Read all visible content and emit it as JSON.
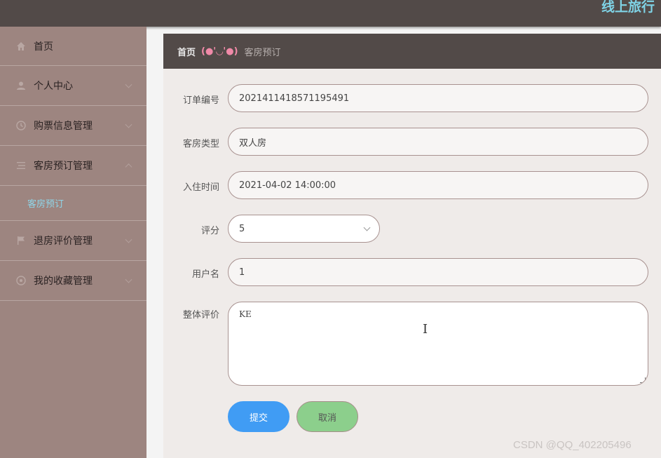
{
  "app": {
    "title": "线上旅行"
  },
  "sidebar": {
    "items": [
      {
        "label": "首页",
        "icon": "home-icon"
      },
      {
        "label": "个人中心",
        "icon": "user-icon"
      },
      {
        "label": "购票信息管理",
        "icon": "ticket-icon"
      },
      {
        "label": "客房预订管理",
        "icon": "list-icon",
        "expanded": true,
        "children": [
          {
            "label": "客房预订"
          }
        ]
      },
      {
        "label": "退房评价管理",
        "icon": "flag-icon"
      },
      {
        "label": "我的收藏管理",
        "icon": "star-icon"
      }
    ]
  },
  "breadcrumb": {
    "home": "首页",
    "separator": "(●'◡'●)",
    "current": "客房预订"
  },
  "form": {
    "order_no": {
      "label": "订单编号",
      "value": "2021411418571195491"
    },
    "room_type": {
      "label": "客房类型",
      "value": "双人房"
    },
    "checkin_time": {
      "label": "入住时间",
      "value": "2021-04-02 14:00:00"
    },
    "rating": {
      "label": "评分",
      "value": "5"
    },
    "username": {
      "label": "用户名",
      "value": "1"
    },
    "review": {
      "label": "整体评价",
      "value": "KE"
    }
  },
  "buttons": {
    "submit": "提交",
    "cancel": "取消"
  },
  "watermark": "CSDN @QQ_402205496",
  "colors": {
    "header": "#524a48",
    "sidebar": "#9d8580",
    "accent_cyan": "#7fd3e6",
    "submit": "#409cf4",
    "cancel": "#8ccf8c"
  }
}
